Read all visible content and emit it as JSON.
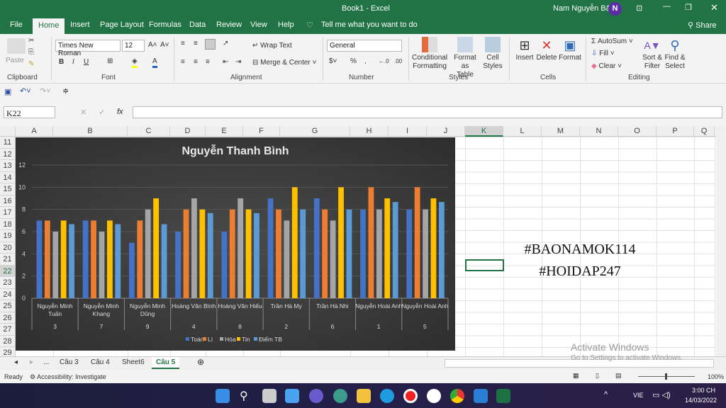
{
  "window": {
    "title": "Book1  -  Excel",
    "user": "Nam Nguyễn Bảo",
    "avatar": "N"
  },
  "tabs": [
    "File",
    "Home",
    "Insert",
    "Page Layout",
    "Formulas",
    "Data",
    "Review",
    "View",
    "Help"
  ],
  "tell_me": "Tell me what you want to do",
  "share": "Share",
  "ribbon": {
    "clipboard": {
      "paste": "Paste",
      "label": "Clipboard"
    },
    "font": {
      "name": "Times New Roman",
      "size": "12",
      "bold": "B",
      "italic": "I",
      "underline": "U",
      "label": "Font"
    },
    "alignment": {
      "wrap": "Wrap Text",
      "merge": "Merge & Center",
      "label": "Alignment"
    },
    "number": {
      "format": "General",
      "percent": "%",
      "comma": ",",
      "label": "Number"
    },
    "styles": {
      "conditional": "Conditional",
      "conditional2": "Formatting",
      "format_table": "Format as",
      "format_table2": "Table",
      "cell_styles": "Cell",
      "cell_styles2": "Styles",
      "label": "Styles"
    },
    "cells": {
      "insert": "Insert",
      "delete": "Delete",
      "format": "Format",
      "label": "Cells"
    },
    "editing": {
      "autosum": "AutoSum",
      "fill": "Fill",
      "clear": "Clear",
      "sort": "Sort &",
      "sort2": "Filter",
      "find": "Find &",
      "find2": "Select",
      "label": "Editing"
    }
  },
  "formula_bar": {
    "name_box": "K22",
    "fx": "fx",
    "value": ""
  },
  "columns": [
    "A",
    "B",
    "C",
    "D",
    "E",
    "F",
    "G",
    "H",
    "I",
    "J",
    "K",
    "L",
    "M",
    "N",
    "O",
    "P",
    "Q"
  ],
  "rows": [
    "11",
    "12",
    "13",
    "14",
    "15",
    "16",
    "17",
    "18",
    "19",
    "20",
    "21",
    "22",
    "23",
    "24",
    "25",
    "26",
    "27",
    "28",
    "29"
  ],
  "cells": {
    "n21": "#BAONAMOK114",
    "n23": "#HOIDAP247"
  },
  "sheets": {
    "more": "...",
    "tabs": [
      "Câu 3",
      "Câu 4",
      "Sheet6",
      "Câu 5"
    ],
    "active": "Câu 5"
  },
  "status": {
    "ready": "Ready",
    "accessibility": "Accessibility: Investigate",
    "zoom": "100%"
  },
  "watermark": {
    "line1": "Activate Windows",
    "line2": "Go to Settings to activate Windows."
  },
  "taskbar": {
    "lang": "VIE",
    "time": "3:00 CH",
    "date": "14/03/2022"
  },
  "chart_data": {
    "type": "bar",
    "title": "Nguyễn Thanh Bình",
    "categories": [
      [
        "Nguyễn Minh",
        "Tuấn",
        "3"
      ],
      [
        "Nguyễn Minh",
        "Khang",
        "7"
      ],
      [
        "Nguyễn Minh",
        "Dũng",
        "9"
      ],
      [
        "Hoàng Văn Bình",
        "",
        "4"
      ],
      [
        "Hoàng Văn Hiếu",
        "",
        "8"
      ],
      [
        "Trần Hà My",
        "",
        "2"
      ],
      [
        "Trần Hà Nhi",
        "",
        "6"
      ],
      [
        "Nguyễn Hoài Anh",
        "",
        "1"
      ],
      [
        "Nguyễn Hoài Anh",
        "",
        "5"
      ]
    ],
    "series": [
      {
        "name": "Toán",
        "color": "#4472c4",
        "values": [
          7,
          7,
          5,
          6,
          6,
          9,
          9,
          8,
          8
        ]
      },
      {
        "name": "Lí",
        "color": "#ed7d31",
        "values": [
          7,
          7,
          7,
          8,
          8,
          8,
          8,
          10,
          10
        ]
      },
      {
        "name": "Hóa",
        "color": "#a5a5a5",
        "values": [
          6,
          6,
          8,
          9,
          9,
          7,
          7,
          8,
          8
        ]
      },
      {
        "name": "Tin",
        "color": "#ffc000",
        "values": [
          7,
          7,
          9,
          8,
          8,
          10,
          10,
          9,
          9
        ]
      },
      {
        "name": "Điểm TB",
        "color": "#5b9bd5",
        "values": [
          6.67,
          6.67,
          6.67,
          7.67,
          7.67,
          8,
          8,
          8.67,
          8.67
        ]
      }
    ],
    "yticks": [
      "0",
      "2",
      "4",
      "6",
      "8",
      "10",
      "12"
    ],
    "ylim": [
      0,
      12
    ],
    "grid": true,
    "legend": "bottom"
  }
}
